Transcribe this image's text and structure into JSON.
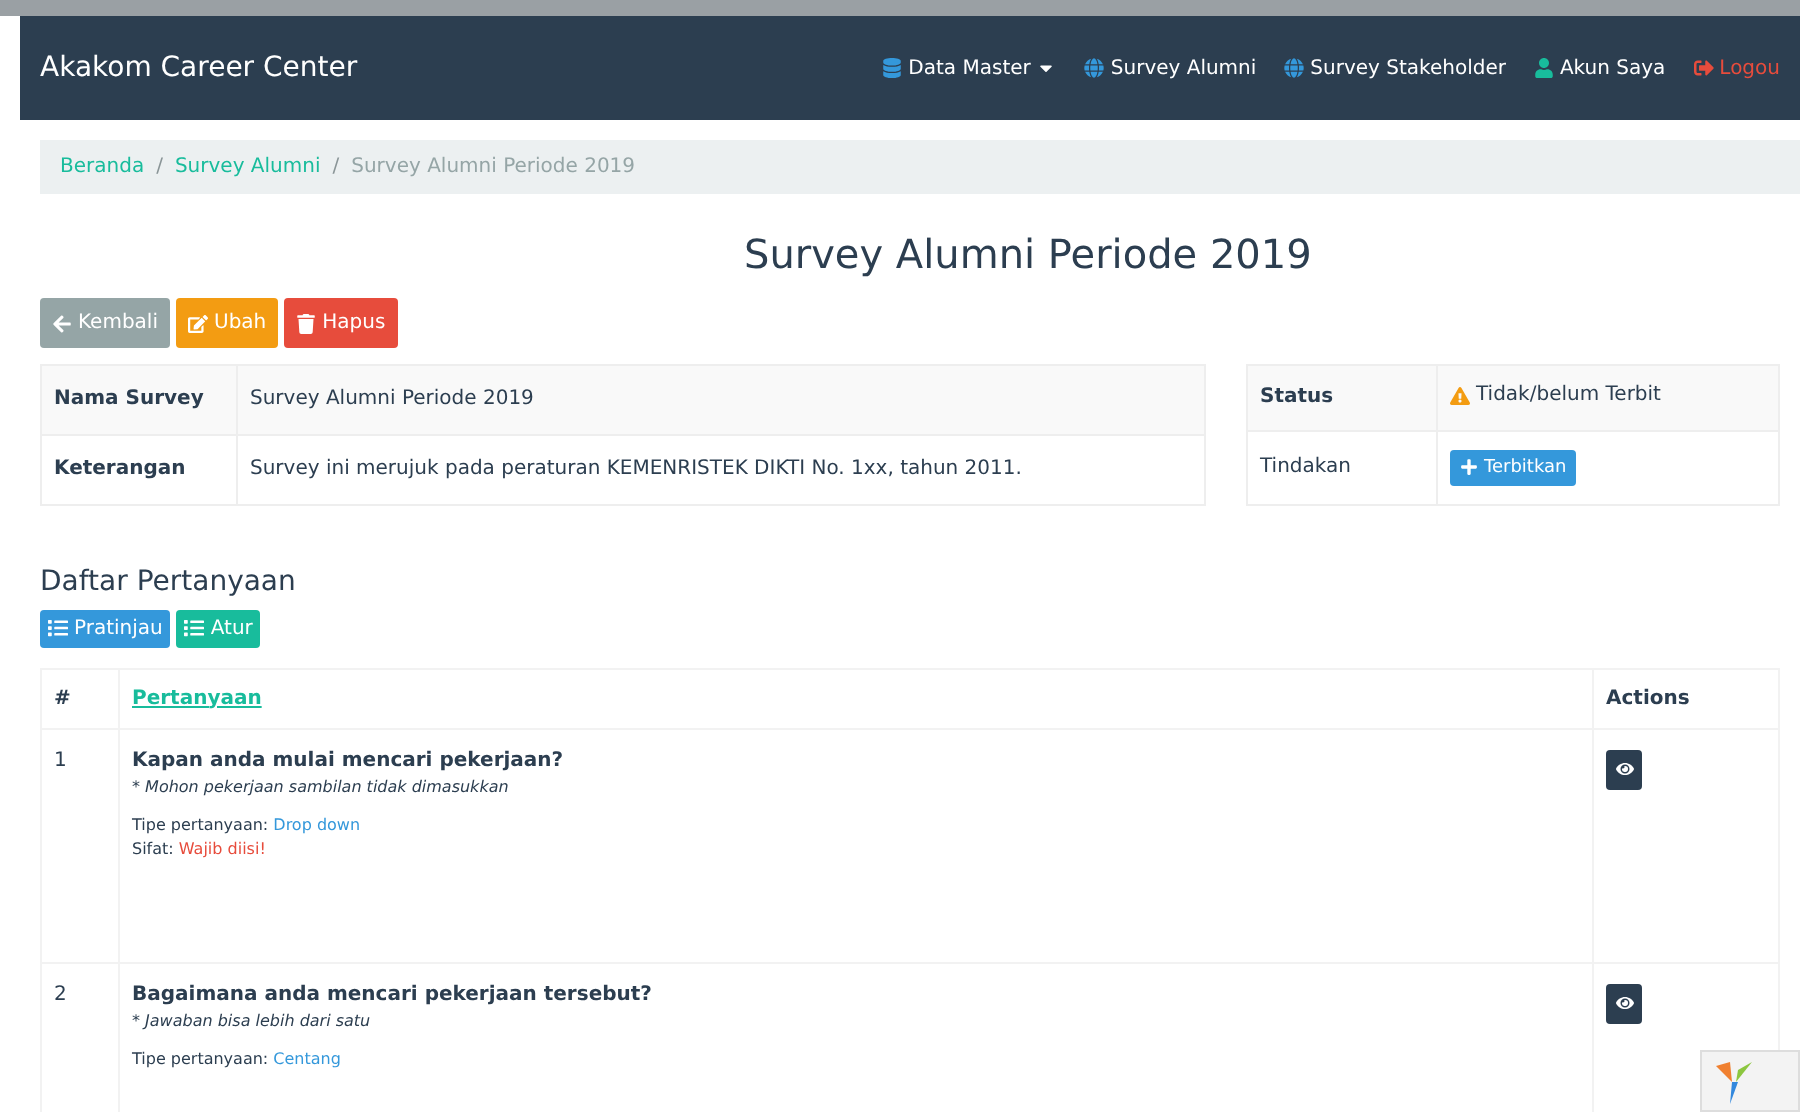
{
  "navbar": {
    "brand": "Akakom Career Center",
    "items": [
      {
        "label": "Data Master",
        "kind": "database",
        "dropdown": true
      },
      {
        "label": "Survey Alumni",
        "kind": "globe",
        "dropdown": false
      },
      {
        "label": "Survey Stakeholder",
        "kind": "globe",
        "dropdown": false
      },
      {
        "label": "Akun Saya",
        "kind": "user",
        "dropdown": false
      },
      {
        "label": "Logou",
        "kind": "logout",
        "dropdown": false
      }
    ]
  },
  "breadcrumb": [
    {
      "label": "Beranda",
      "link": true
    },
    {
      "label": "Survey Alumni",
      "link": true
    },
    {
      "label": "Survey Alumni Periode 2019",
      "link": false
    }
  ],
  "breadcrumb_separator": "/",
  "title": "Survey Alumni Periode 2019",
  "actions": [
    {
      "label": "Kembali",
      "kind": "back"
    },
    {
      "label": "Ubah",
      "kind": "edit"
    },
    {
      "label": "Hapus",
      "kind": "delete"
    }
  ],
  "details": [
    {
      "label": "Nama Survey",
      "value": "Survey Alumni Periode 2019"
    },
    {
      "label": "Keterangan",
      "value": "Survey ini merujuk pada peraturan KEMENRISTEK DIKTI No. 1xx, tahun 2011."
    }
  ],
  "status": {
    "label": "Status",
    "value": "Tidak/belum Terbit",
    "action_label": "Tindakan",
    "action": "Terbitkan"
  },
  "questions_heading": "Daftar Pertanyaan",
  "question_buttons": [
    {
      "label": "Pratinjau",
      "kind": "preview"
    },
    {
      "label": "Atur",
      "kind": "manage"
    }
  ],
  "table": {
    "columns": [
      "#",
      "Pertanyaan",
      "Actions"
    ],
    "rows": [
      {
        "number": "1",
        "question": "Kapan anda mulai mencari pekerjaan?",
        "note": "* Mohon pekerjaan sambilan tidak dimasukkan",
        "type_label": "Tipe pertanyaan:",
        "type": "Drop down",
        "trait_label": "Sifat:",
        "trait": "Wajib diisi!"
      },
      {
        "number": "2",
        "question": "Bagaimana anda mencari pekerjaan tersebut?",
        "note": "* Jawaban bisa lebih dari satu",
        "type_label": "Tipe pertanyaan:",
        "type": "Centang"
      }
    ]
  }
}
